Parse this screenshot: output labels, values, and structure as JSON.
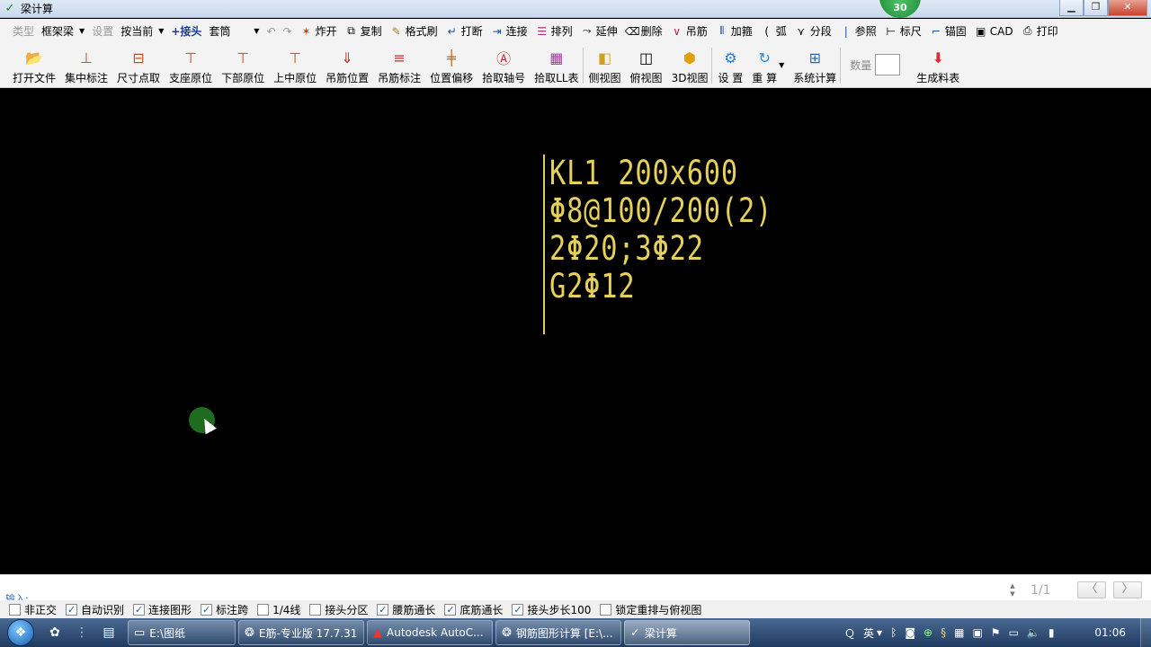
{
  "window": {
    "title": "梁计算",
    "badge": "30",
    "min_label": "▁",
    "max_label": "❐",
    "close_label": "✕"
  },
  "toolbar1": {
    "type_label": "类型",
    "type_value": "框架梁",
    "settings_label": "设置",
    "mode_value": "按当前",
    "joint": "+接头",
    "sleeve_value": "套筒",
    "undo": "↶",
    "redo": "↷",
    "explode": "炸开",
    "copy": "复制",
    "format_brush": "格式刷",
    "break": "打断",
    "connect": "连接",
    "arrange": "排列",
    "extend": "延伸",
    "delete": "删除",
    "hanger": "吊筋",
    "add_stirrup": "加箍",
    "arc": "弧",
    "segment": "分段",
    "reference": "参照",
    "ruler": "标尺",
    "anchor": "锚固",
    "cad": "CAD",
    "print": "打印"
  },
  "toolbar2": {
    "open_file": "打开文件",
    "concentrated_mark": "集中标注",
    "size_pick": "尺寸点取",
    "support_orig": "支座原位",
    "lower_orig": "下部原位",
    "upper_mid_orig": "上中原位",
    "hanger_pos": "吊筋位置",
    "hanger_mark": "吊筋标注",
    "pos_offset": "位置偏移",
    "pick_axis": "拾取轴号",
    "pick_ll": "拾取LL表",
    "side_view": "侧视图",
    "top_view": "俯视图",
    "view_3d": "3D视图",
    "settings": "设 置",
    "recalc": "重 算",
    "sys_calc": "系统计算",
    "qty_label": "数量",
    "qty_value": "",
    "gen_table": "生成料表"
  },
  "canvas": {
    "annotation": [
      "KL1 200x600",
      "Φ8@100/200(2)",
      "2Φ20;3Φ22",
      "G2Φ12"
    ],
    "text_color": "#e5d15a"
  },
  "command": {
    "prompt": "输入:",
    "value": "",
    "page": "1/1",
    "prev": "〈",
    "next": "〉"
  },
  "status": {
    "items": [
      {
        "label": "非正交",
        "checked": false
      },
      {
        "label": "自动识别",
        "checked": true
      },
      {
        "label": "连接图形",
        "checked": true
      },
      {
        "label": "标注跨",
        "checked": true
      },
      {
        "label": "1/4线",
        "checked": false
      },
      {
        "label": "接头分区",
        "checked": false
      },
      {
        "label": "腰筋通长",
        "checked": true
      },
      {
        "label": "底筋通长",
        "checked": true
      },
      {
        "label": "接头步长100",
        "checked": true
      },
      {
        "label": "锁定重排与俯视图",
        "checked": false
      }
    ]
  },
  "taskbar": {
    "tasks": [
      {
        "label": "E:\\图纸",
        "icon": "folder-icon"
      },
      {
        "label": "E筋-专业版 17.7.31",
        "icon": "app-icon"
      },
      {
        "label": "Autodesk AutoC...",
        "icon": "autocad-icon"
      },
      {
        "label": "钢筋图形计算 [E:\\...",
        "icon": "app-icon"
      },
      {
        "label": "梁计算",
        "icon": "beam-icon"
      }
    ],
    "ime": "英",
    "clock": "01:06"
  },
  "colors": {
    "canvas_bg": "#000000",
    "toolbar_bg": "#f3f3f3",
    "taskbar": "#2b4a72",
    "cad_yellow": "#e5d15a"
  }
}
